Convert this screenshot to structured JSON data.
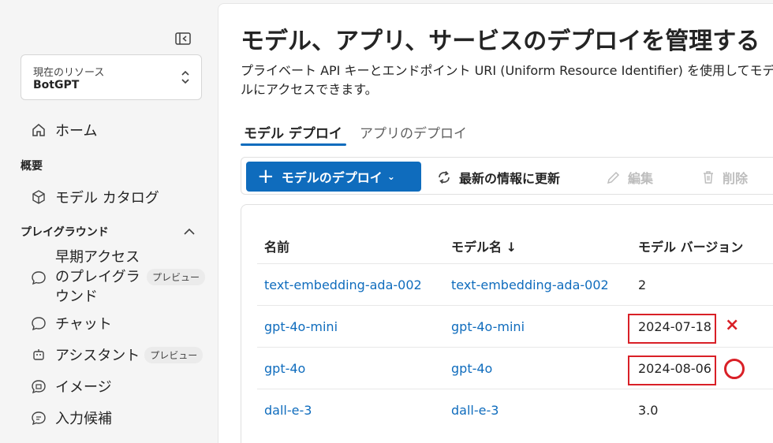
{
  "sidebar": {
    "resource_label": "現在のリソース",
    "resource_name": "BotGPT",
    "home": "ホーム",
    "section_overview": "概要",
    "model_catalog": "モデル カタログ",
    "section_playground": "プレイグラウンド",
    "early_access": "早期アクセスのプレイグラウンド",
    "early_access_badge": "プレビュー",
    "chat": "チャット",
    "assistant": "アシスタント",
    "assistant_badge": "プレビュー",
    "image": "イメージ",
    "completions": "入力候補"
  },
  "main": {
    "title": "モデル、アプリ、サービスのデプロイを管理する",
    "description": "プライベート API キーとエンドポイント URI (Uniform Resource Identifier) を使用してモデルにアクセスできます。",
    "tabs": [
      {
        "label": "モデル デプロイ",
        "active": true
      },
      {
        "label": "アプリのデプロイ",
        "active": false
      }
    ],
    "toolbar": {
      "deploy": "モデルのデプロイ",
      "refresh": "最新の情報に更新",
      "edit": "編集",
      "delete": "削除"
    },
    "table": {
      "columns": [
        "名前",
        "モデル名 ↓",
        "モデル バージョン"
      ],
      "rows": [
        {
          "name": "text-embedding-ada-002",
          "model": "text-embedding-ada-002",
          "version": "2"
        },
        {
          "name": "gpt-4o-mini",
          "model": "gpt-4o-mini",
          "version": "2024-07-18",
          "mark": "×"
        },
        {
          "name": "gpt-4o",
          "model": "gpt-4o",
          "version": "2024-08-06",
          "mark": "○"
        },
        {
          "name": "dall-e-3",
          "model": "dall-e-3",
          "version": "3.0"
        }
      ]
    }
  },
  "colors": {
    "accent": "#0f6cbd",
    "annotation": "#d92027"
  },
  "icons": [
    "collapse-panel-icon",
    "chevron-updown-icon",
    "home-icon",
    "cube-icon",
    "chevron-up-icon",
    "chat-icon",
    "bot-icon",
    "image-icon",
    "text-icon",
    "plus-icon",
    "refresh-icon",
    "pencil-icon",
    "trash-icon"
  ]
}
